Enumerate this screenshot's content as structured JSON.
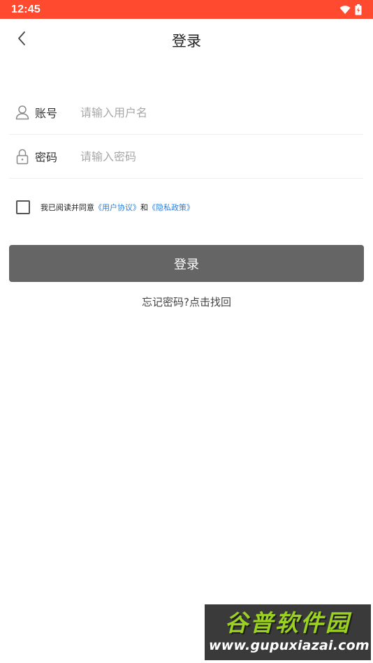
{
  "status_bar": {
    "time": "12:45",
    "background": "#ff4a2f",
    "icons": [
      "wifi-icon",
      "battery-icon"
    ]
  },
  "header": {
    "title": "登录",
    "back_icon": "chevron-left-icon"
  },
  "form": {
    "username": {
      "icon": "user-icon",
      "label": "账号",
      "placeholder": "请输入用户名",
      "value": ""
    },
    "password": {
      "icon": "lock-icon",
      "label": "密码",
      "placeholder": "请输入密码",
      "value": ""
    }
  },
  "agreement": {
    "checked": false,
    "prefix": "我已阅读并同意",
    "user_agreement": "《用户协议》",
    "and": "和",
    "privacy_policy": "《隐私政策》",
    "link_color": "#2f7fd8"
  },
  "login_button": {
    "label": "登录",
    "background": "#656565"
  },
  "forgot_password": "忘记密码?点击找回",
  "watermark": {
    "logo": "谷普软件园",
    "url": "www.gupuxiazai.com"
  }
}
